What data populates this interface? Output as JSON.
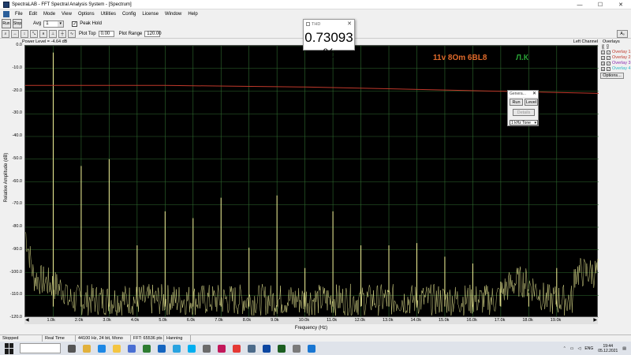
{
  "window": {
    "title": "SpectraLAB - FFT Spectral Analysis System - [Spectrum]",
    "minimize": "—",
    "maximize": "☐",
    "close": "✕"
  },
  "menu": [
    "File",
    "Edit",
    "Mode",
    "View",
    "Options",
    "Utilities",
    "Config",
    "License",
    "Window",
    "Help"
  ],
  "toolbar1": {
    "btn_run": "Run",
    "btn_stop": "Stop",
    "avg_label": "Avg",
    "avg_value": "1",
    "peak_hold_checked": true,
    "peak_hold_label": "Peak Hold"
  },
  "toolbar2": {
    "plot_top_label": "Plot Top",
    "plot_top_value": "0.00",
    "plot_range_label": "Plot Range",
    "plot_range_value": "120.00",
    "right_icon": "Aₒ"
  },
  "plot": {
    "power_level": "Power Level = -4.64 dB",
    "channel": "Left Channel",
    "annotation_main": "11v  8Om   6BL8",
    "annotation_right": "Л.К",
    "annotation_main_color": "#e06a2a",
    "annotation_right_color": "#29a336",
    "trace_color": "#f5f59a",
    "overlay_color": "#c0392b",
    "grid_color": "#2f6b2f"
  },
  "chart_data": {
    "type": "line",
    "xlabel": "Frequency (Hz)",
    "ylabel": "Relative Amplitude (dB)",
    "xlim": [
      0,
      20500
    ],
    "ylim": [
      -120,
      0
    ],
    "x_ticks": [
      "1.0k",
      "2.0k",
      "3.0k",
      "4.0k",
      "5.0k",
      "6.0k",
      "7.0k",
      "8.0k",
      "9.0k",
      "10.0k",
      "11.0k",
      "12.0k",
      "13.0k",
      "14.0k",
      "15.0k",
      "16.0k",
      "17.0k",
      "18.0k",
      "19.0k"
    ],
    "y_ticks": [
      "0.0",
      "-10.0",
      "-20.0",
      "-30.0",
      "-40.0",
      "-50.0",
      "-60.0",
      "-70.0",
      "-80.0",
      "-90.0",
      "-100.0",
      "-110.0",
      "-120.0"
    ],
    "peaks": {
      "x": [
        1000,
        2000,
        3000,
        4000,
        5000,
        6000,
        7000,
        8000,
        9000,
        10000,
        11000,
        12000,
        13000,
        14000,
        15000,
        16000,
        17000,
        18000,
        19000
      ],
      "y": [
        -3,
        -53,
        -50,
        -88,
        -73,
        -76,
        -67,
        -89,
        -66,
        -98,
        -73,
        -88,
        -88,
        -87,
        -93,
        -96,
        -104,
        -109,
        -98
      ]
    },
    "overlay_line": {
      "x": [
        0,
        5000,
        10000,
        15000,
        20500
      ],
      "y": [
        -17.5,
        -17.5,
        -18.2,
        -19.5,
        -21
      ]
    }
  },
  "overlays": {
    "header": "Overlays",
    "sel": "Sel",
    "on": "On",
    "items": [
      {
        "num": "1",
        "label": "Overlay 1",
        "color": "#c0392b"
      },
      {
        "num": "2",
        "label": "Overlay 2",
        "color": "#c0392b"
      },
      {
        "num": "3",
        "label": "Overlay 3",
        "color": "#8a2ab0"
      },
      {
        "num": "4",
        "label": "Overlay 4",
        "color": "#2bb8c8"
      }
    ],
    "options_label": "Options..."
  },
  "thd_window": {
    "title": "THD",
    "value": "0.73093 %"
  },
  "generator_window": {
    "title": "Genera...",
    "run": "Run",
    "level": "Level",
    "details": "Details",
    "tone": "1 kHz Tone"
  },
  "status": {
    "state": "Stopped",
    "mode": "Real Time",
    "format": "44100 Hz, 24 bit, Mono",
    "fft": "FFT: 65536 pts",
    "window": "Hanning"
  },
  "taskbar": {
    "language": "ENG",
    "time": "19:44",
    "date": "05.12.2021"
  }
}
